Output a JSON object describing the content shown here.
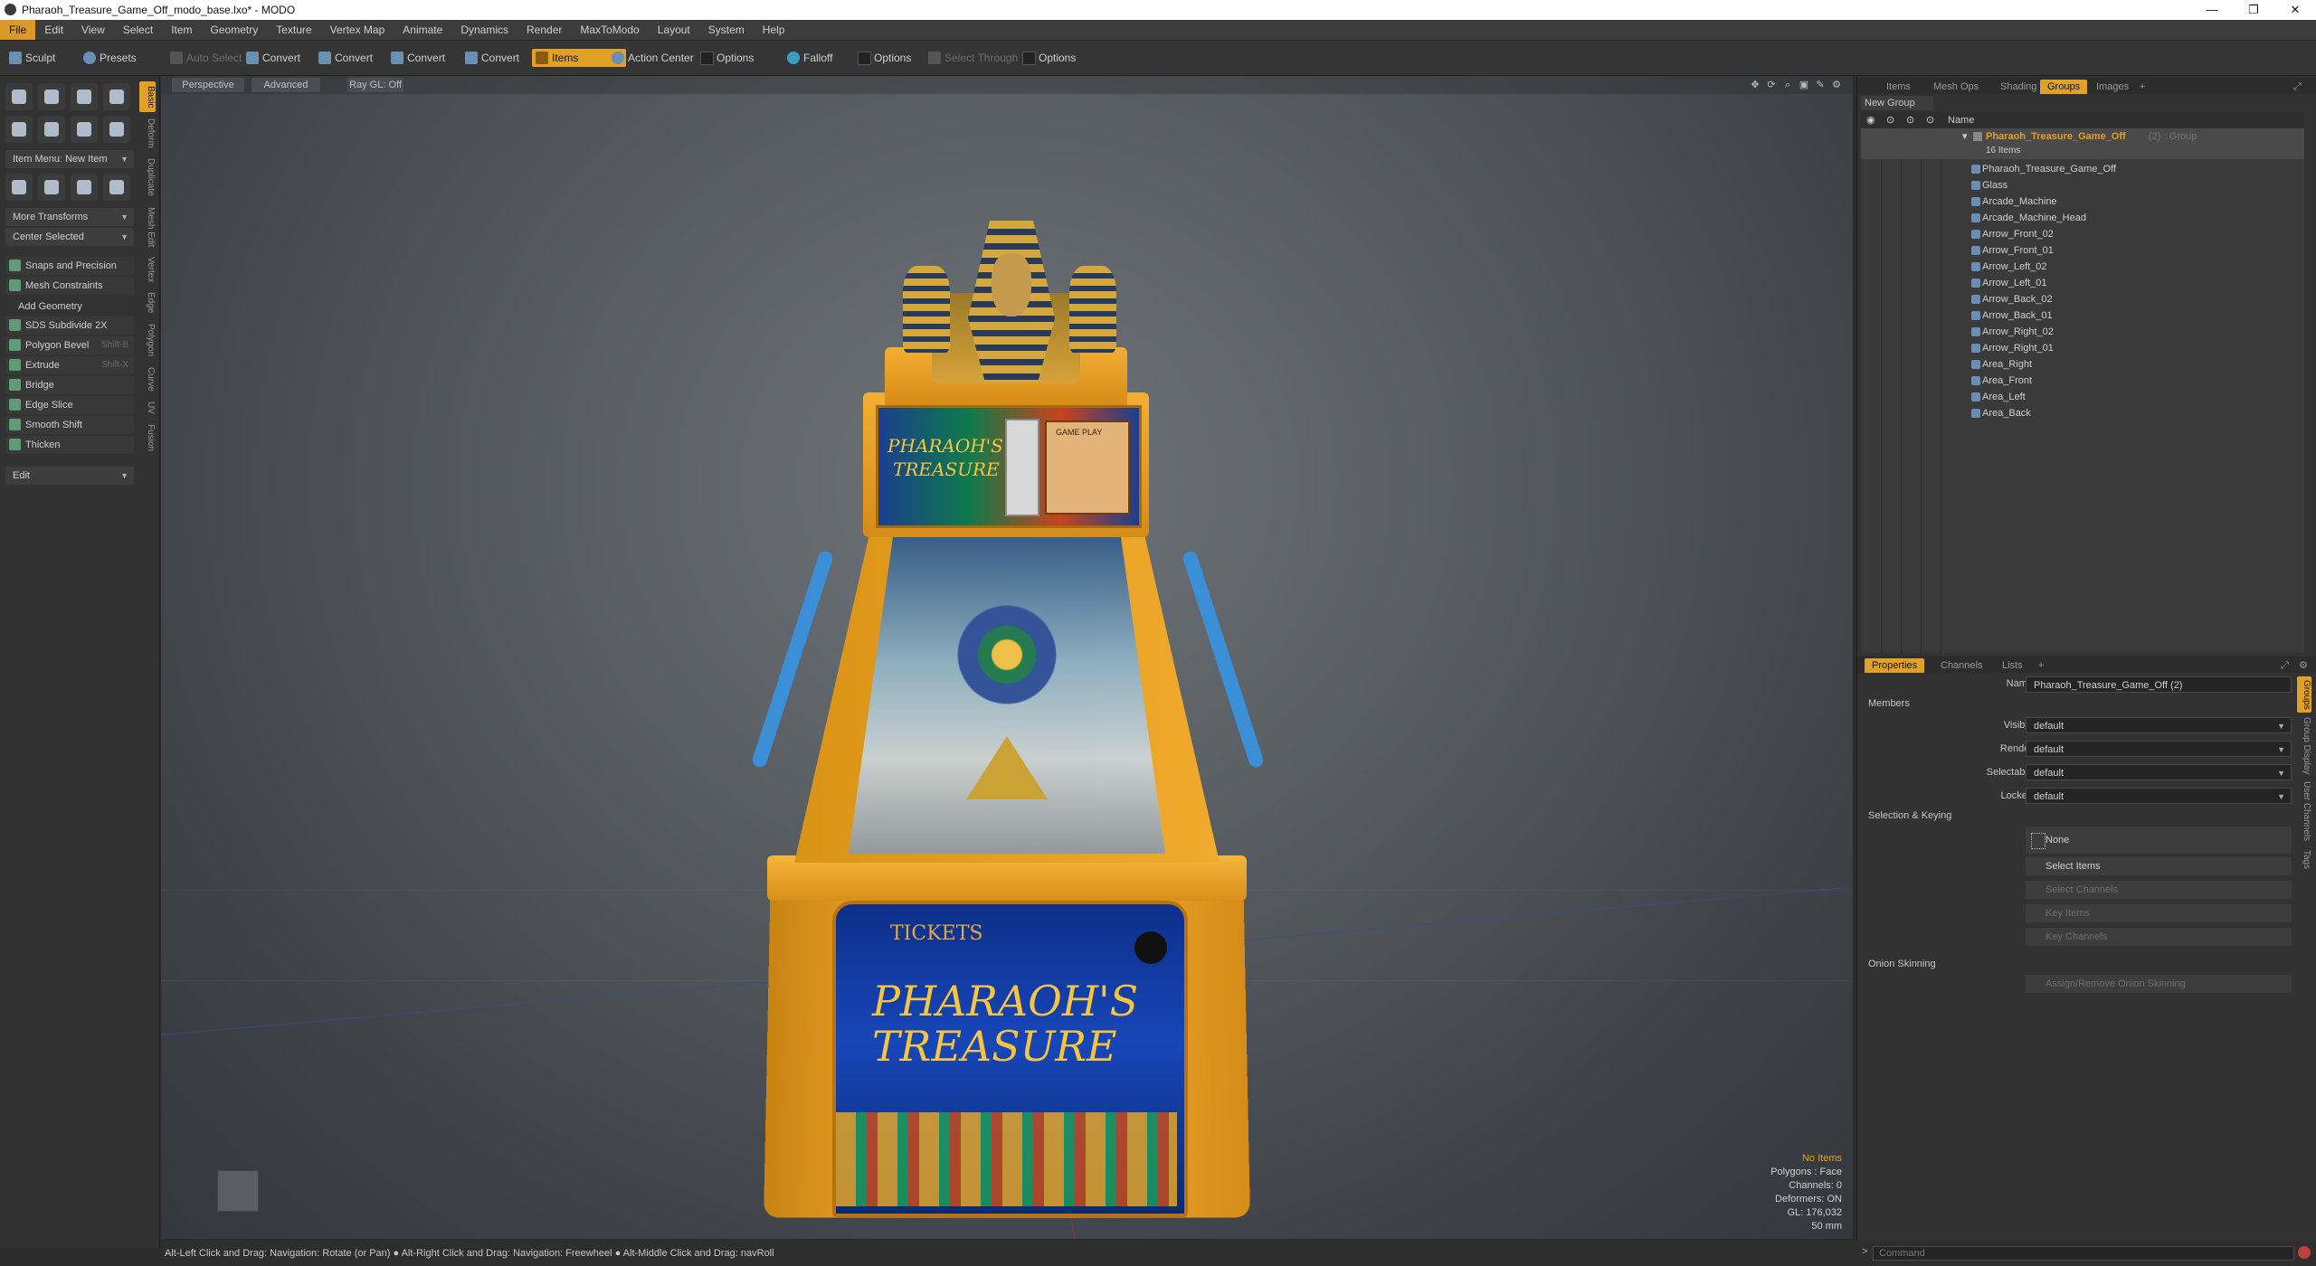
{
  "window": {
    "title": "Pharaoh_Treasure_Game_Off_modo_base.lxo* - MODO",
    "minimize": "—",
    "maximize": "❐",
    "close": "✕"
  },
  "menu": [
    "File",
    "Edit",
    "View",
    "Select",
    "Item",
    "Geometry",
    "Texture",
    "Vertex Map",
    "Animate",
    "Dynamics",
    "Render",
    "MaxToModo",
    "Layout",
    "System",
    "Help"
  ],
  "toolbar": {
    "sculpt": "Sculpt",
    "presets": "Presets",
    "auto_select": "Auto Select",
    "convert1": "Convert",
    "convert2": "Convert",
    "convert3": "Convert",
    "convert4": "Convert",
    "items": "Items",
    "action_center": "Action Center",
    "options1": "Options",
    "falloff": "Falloff",
    "options2": "Options",
    "select_through": "Select Through",
    "options3": "Options"
  },
  "left": {
    "item_menu": "Item Menu: New Item",
    "more_transforms": "More Transforms",
    "center_selected": "Center Selected",
    "snaps": "Snaps and Precision",
    "mesh_constraints": "Mesh Constraints",
    "add_geometry": "Add Geometry",
    "tools": [
      {
        "label": "SDS Subdivide 2X",
        "shortcut": ""
      },
      {
        "label": "Polygon Bevel",
        "shortcut": "Shift-B"
      },
      {
        "label": "Extrude",
        "shortcut": "Shift-X"
      },
      {
        "label": "Bridge",
        "shortcut": ""
      },
      {
        "label": "Edge Slice",
        "shortcut": ""
      },
      {
        "label": "Smooth Shift",
        "shortcut": ""
      },
      {
        "label": "Thicken",
        "shortcut": ""
      }
    ],
    "edit": "Edit",
    "vtabs": [
      "Basic",
      "Deform",
      "Duplicate",
      "Mesh Edit",
      "Vertex",
      "Edge",
      "Polygon",
      "Curve",
      "UV",
      "Fusion"
    ]
  },
  "viewport": {
    "perspective": "Perspective",
    "advanced": "Advanced",
    "raygl": "Ray GL: Off",
    "stats": {
      "no_items": "No Items",
      "polygons": "Polygons : Face",
      "channels": "Channels: 0",
      "deformers": "Deformers: ON",
      "gl": "GL: 176,032",
      "mm": "50 mm"
    },
    "machine": {
      "marquee_line1": "PHARAOH'S",
      "marquee_line2": "TREASURE",
      "front_tickets": "TICKETS",
      "front_line1": "PHARAOH'S",
      "front_line2": "TREASURE",
      "game_play": "GAME PLAY"
    }
  },
  "right": {
    "tabs": [
      "Items",
      "Mesh Ops",
      "Shading",
      "Groups",
      "Images",
      "+"
    ],
    "new_group": "New Group",
    "col_name": "Name",
    "group_name": "Pharaoh_Treasure_Game_Off",
    "group_count": "(2) : Group",
    "group_items": "16 Items",
    "items": [
      "Pharaoh_Treasure_Game_Off",
      "Glass",
      "Arcade_Machine",
      "Arcade_Machine_Head",
      "Arrow_Front_02",
      "Arrow_Front_01",
      "Arrow_Left_02",
      "Arrow_Left_01",
      "Arrow_Back_02",
      "Arrow_Back_01",
      "Arrow_Right_02",
      "Arrow_Right_01",
      "Area_Right",
      "Area_Front",
      "Area_Left",
      "Area_Back"
    ],
    "prop_tabs": [
      "Properties",
      "Channels",
      "Lists",
      "+"
    ],
    "name_label": "Name",
    "name_value": "Pharaoh_Treasure_Game_Off (2)",
    "members": "Members",
    "visible_label": "Visible",
    "visible": "default",
    "render_label": "Render",
    "render": "default",
    "selectable_label": "Selectable",
    "selectable": "default",
    "locked_label": "Locked",
    "locked": "default",
    "selection_keying": "Selection & Keying",
    "none": "None",
    "select_items": "Select Items",
    "select_channels": "Select Channels",
    "key_items": "Key Items",
    "key_channels": "Key Channels",
    "onion": "Onion Skinning",
    "assign_onion": "Assign/Remove Onion Skinning",
    "vtabs": [
      "Groups",
      "Group Display",
      "User Channels",
      "Tags"
    ]
  },
  "status": "Alt-Left Click and Drag: Navigation: Rotate (or Pan) ● Alt-Right Click and Drag: Navigation: Freewheel ● Alt-Middle Click and Drag: navRoll",
  "command_placeholder": "Command"
}
